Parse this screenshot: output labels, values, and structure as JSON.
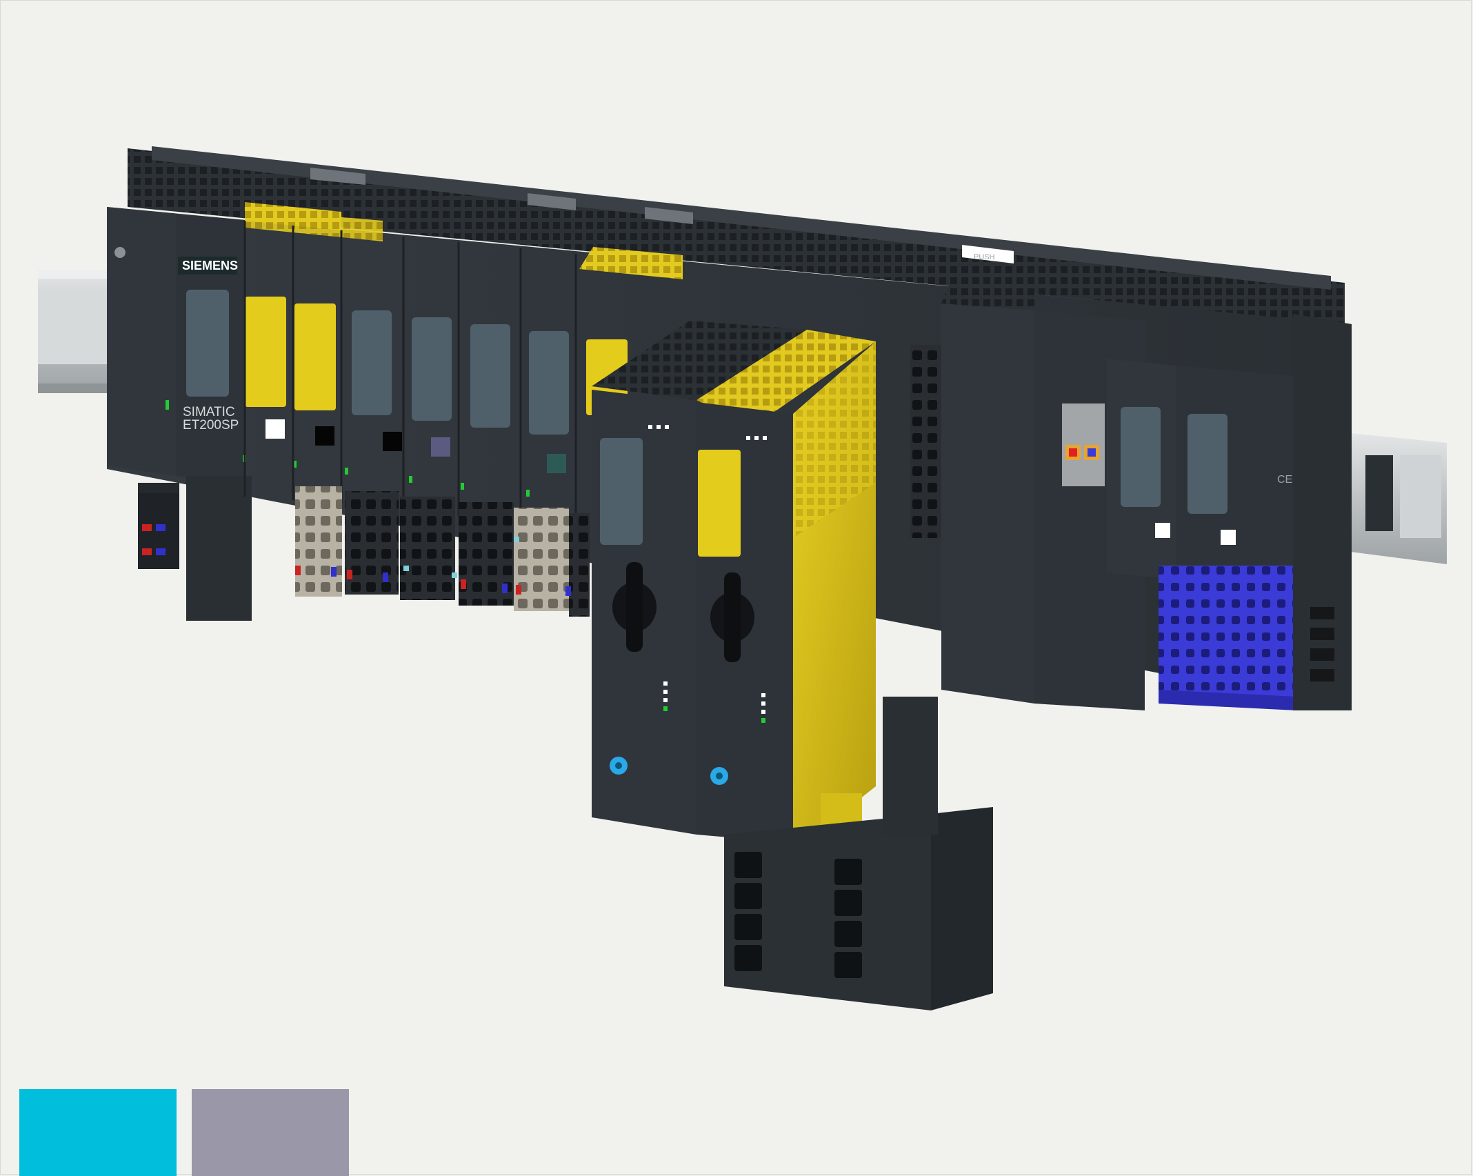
{
  "image": {
    "brand_label": "SIEMENS",
    "product_label_line1": "SIMATIC",
    "product_label_line2": "ET200SP",
    "push_label": "PUSH",
    "ce_mark": "CE"
  },
  "colors": {
    "background": "#f1f2ee",
    "module_body": "#2f353b",
    "module_dark": "#24292e",
    "safety_yellow": "#e4cc1c",
    "dark_yellow": "#b79e12",
    "display_window": "#4f606b",
    "terminal_blue": "#3a3ad6",
    "terminal_beige": "#b8b2a4",
    "led_green": "#22cc33",
    "rail_silver": "#c9ccce",
    "fitting_blue": "#2aa8e8",
    "swatch_cyan": "#00bedc",
    "swatch_grey": "#9a98a8"
  },
  "icons": [
    "din-rail",
    "status-led",
    "rotary-switch",
    "pneumatic-fitting",
    "push-tab"
  ]
}
